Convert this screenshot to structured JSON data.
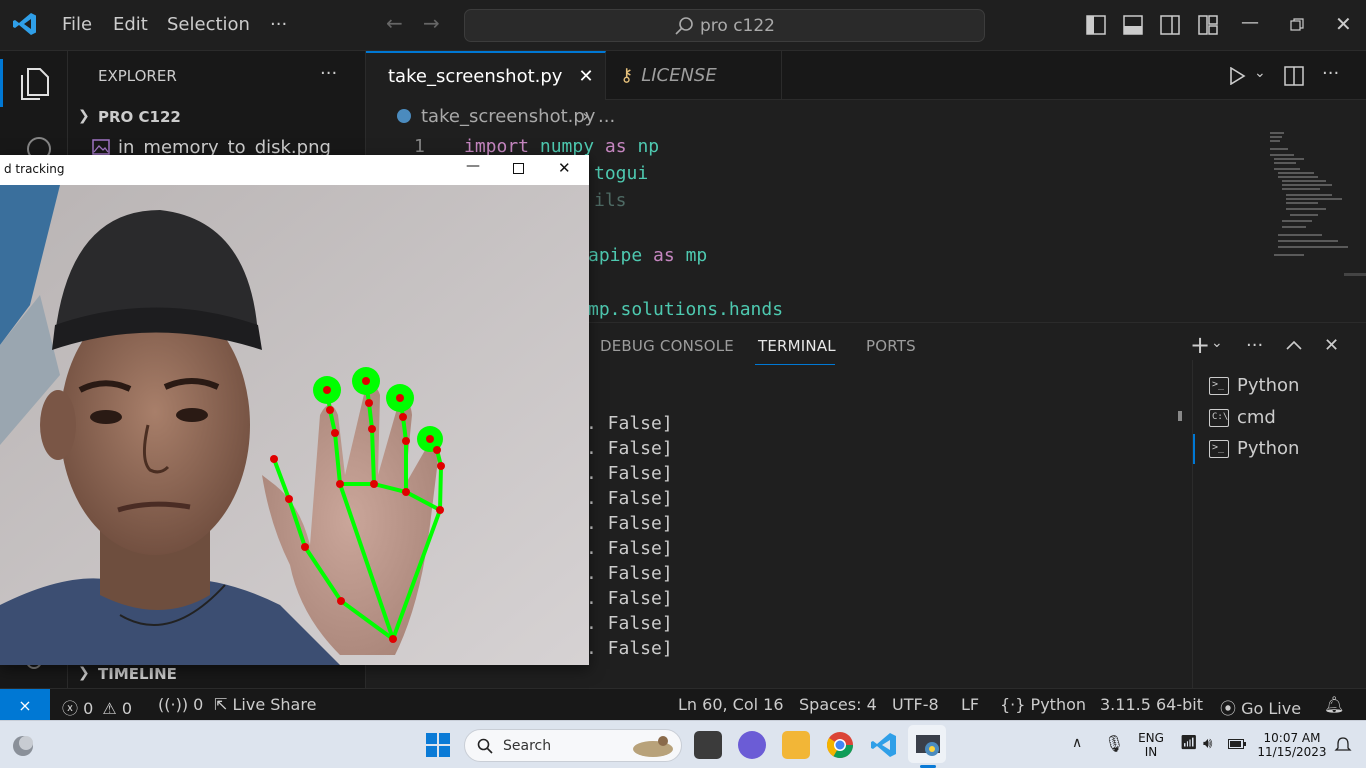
{
  "titlebar": {
    "menu": [
      "File",
      "Edit",
      "Selection",
      "···"
    ],
    "search_text": "pro c122"
  },
  "sidebar": {
    "header": "EXPLORER",
    "more": "···",
    "folder": "PRO C122",
    "file": "in_memory_to_disk.png",
    "timeline": "TIMELINE"
  },
  "editor": {
    "tabs": [
      {
        "label": "take_screenshot.py",
        "active": true
      },
      {
        "label": "LICENSE",
        "active": false
      }
    ],
    "breadcrumb_file": "take_screenshot.py",
    "breadcrumb_rest": "...",
    "lines": [
      {
        "num": "1",
        "kw": "import",
        "mod": "numpy",
        "kw2": "as",
        "alias": "np"
      },
      {
        "visible": "togui"
      },
      {
        "visible": "ils"
      },
      {
        "visible_a": "apipe",
        "kw": "as",
        "alias": "mp"
      },
      {
        "visible": "mp.solutions.hands"
      }
    ]
  },
  "panel": {
    "tabs": [
      "DEBUG CONSOLE",
      "TERMINAL",
      "PORTS"
    ],
    "active_tab": "TERMINAL",
    "terminal_lines": [
      ". False]",
      ". False]",
      ". False]",
      ". False]",
      ". False]",
      ". False]",
      ". False]",
      ". False]",
      ". False]",
      ". False]"
    ],
    "terminals": [
      "Python",
      "cmd",
      "Python"
    ]
  },
  "statusbar": {
    "errors": "0",
    "warnings": "0",
    "ports": "0",
    "live_share": "Live Share",
    "position": "Ln 60, Col 16",
    "spaces": "Spaces: 4",
    "encoding": "UTF-8",
    "eol": "LF",
    "language": "Python",
    "interpreter": "3.11.5 64-bit",
    "go_live": "Go Live"
  },
  "camera_window": {
    "title": "d tracking"
  },
  "taskbar": {
    "search_placeholder": "Search",
    "lang_top": "ENG",
    "lang_bottom": "IN",
    "time": "10:07 AM",
    "date": "11/15/2023"
  },
  "colors": {
    "accent": "#0078d4",
    "hand_line": "#00ff00",
    "hand_point": "#e00000"
  }
}
